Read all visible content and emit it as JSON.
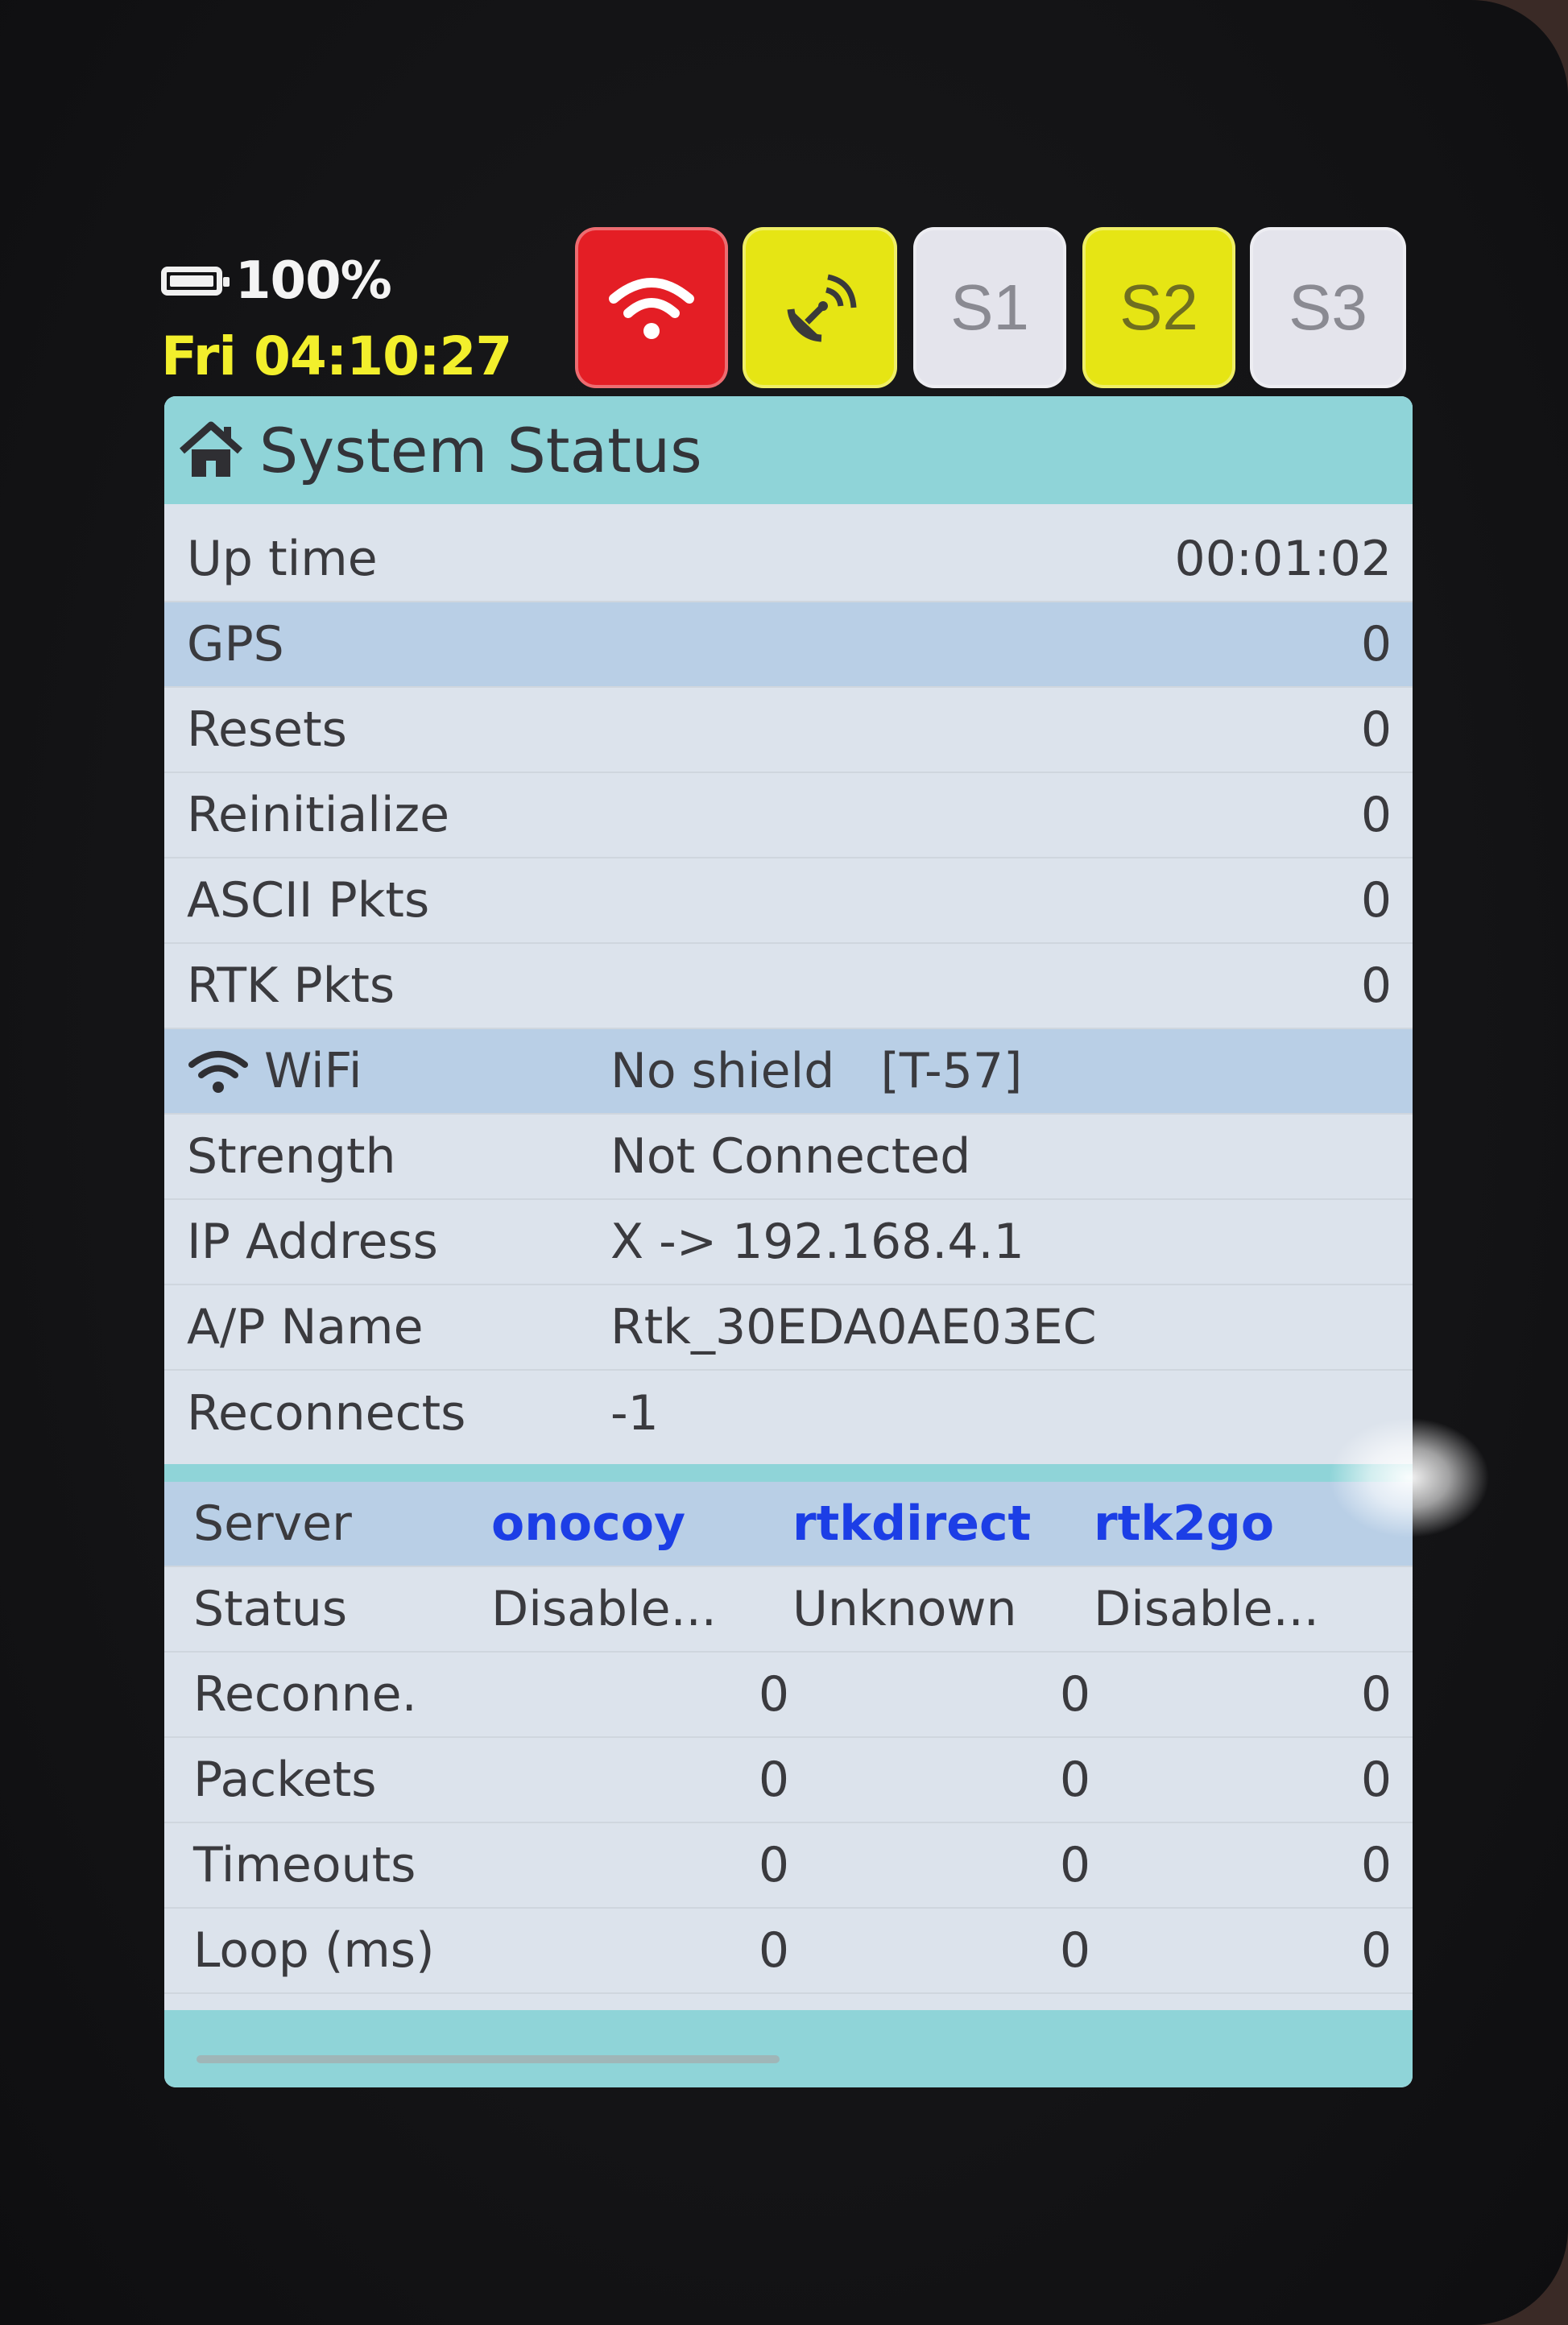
{
  "header": {
    "battery": "100%",
    "clock": "Fri 04:10:27",
    "buttons": {
      "s1": "S1",
      "s2": "S2",
      "s3": "S3"
    },
    "icons": {
      "wifi": "wifi-icon",
      "gnss": "satellite-dish-icon",
      "battery": "battery-icon"
    },
    "colors": {
      "wifi_button": "#e41e25",
      "active_yellow": "#e6e514",
      "inactive": "#e4e4ec",
      "clock": "#f2ef2c"
    }
  },
  "panel": {
    "title": "System Status",
    "title_icon": "home-icon",
    "rows": [
      {
        "label": "Up time",
        "value": "00:01:02"
      },
      {
        "label": "GPS",
        "value": "0"
      },
      {
        "label": "Resets",
        "value": "0"
      },
      {
        "label": "Reinitialize",
        "value": "0"
      },
      {
        "label": "ASCII Pkts",
        "value": "0"
      },
      {
        "label": "RTK Pkts",
        "value": "0"
      }
    ],
    "wifi": {
      "label": "WiFi",
      "value": "No shield   [T-57]",
      "rows": [
        {
          "label": "Strength",
          "value": "Not Connected"
        },
        {
          "label": "IP Address",
          "value": "X -> 192.168.4.1"
        },
        {
          "label": "A/P Name",
          "value": "Rtk_30EDA0AE03EC"
        },
        {
          "label": "Reconnects",
          "value": "-1"
        }
      ]
    },
    "servers": {
      "header_label": "Server",
      "names": [
        "onocoy",
        "rtkdirect",
        "rtk2go"
      ],
      "status_label": "Status",
      "statuses": [
        "Disable...",
        "Unknown",
        "Disable..."
      ],
      "rows": [
        {
          "label": "Reconne.",
          "values": [
            "0",
            "0",
            "0"
          ]
        },
        {
          "label": "Packets",
          "values": [
            "0",
            "0",
            "0"
          ]
        },
        {
          "label": "Timeouts",
          "values": [
            "0",
            "0",
            "0"
          ]
        },
        {
          "label": "Loop (ms)",
          "values": [
            "0",
            "0",
            "0"
          ]
        }
      ],
      "server_color": "#1c3ee6"
    }
  }
}
